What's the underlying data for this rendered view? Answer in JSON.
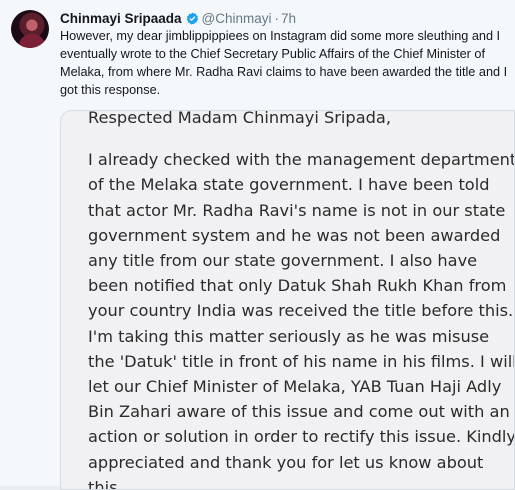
{
  "author": {
    "name": "Chinmayi Sripaada",
    "handle": "@Chinmayi",
    "separator": "·",
    "time": "7h",
    "verified": true,
    "verified_color": "#1da1f2",
    "avatar": "user-avatar"
  },
  "tweet": {
    "text": "However, my dear jimblippippiees on Instagram did some more sleuthing and I eventually wrote to the Chief Secretary Public Affairs of the Chief Minister of Melaka, from where Mr. Radha Ravi claims to have been awarded the title and I got this response."
  },
  "attachment": {
    "salutation": "Respected Madam Chinmayi Sripada,",
    "body": "I already checked with the management department of the Melaka state government. I have been told that actor Mr. Radha Ravi's name is not in our state government system and he was not been awarded any title from our state government. I also have been notified that only Datuk Shah Rukh Khan from your country India was received the title before this. I'm taking this matter seriously as he was misuse the 'Datuk' title in front of his name in his films. I will let our Chief Minister of Melaka, YAB Tuan Haji Adly Bin Zahari aware of this issue and come out with an action or solution in order to rectify this issue. Kindly appreciated and thank you for let us know about this"
  }
}
